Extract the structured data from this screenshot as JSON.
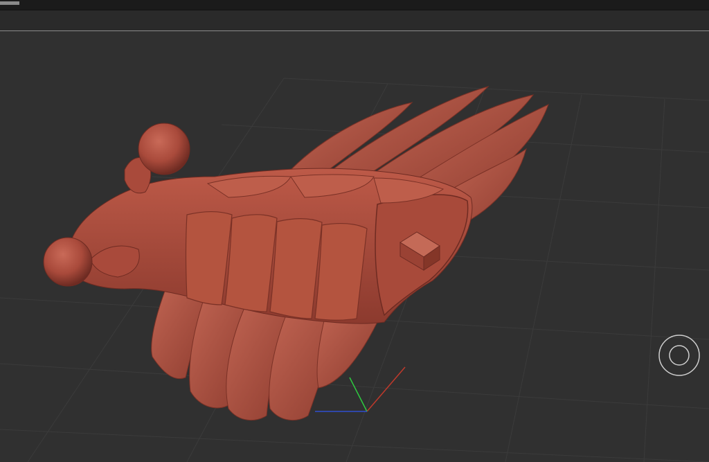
{
  "app": {
    "title": ""
  },
  "viewport": {
    "background": "#303030",
    "grid_color": "#3a3a3a",
    "model_color": "#b0503f",
    "model_shadow": "#7d3227",
    "model_highlight": "#c96a58"
  },
  "axes": {
    "x_color": "#c0392b",
    "y_color": "#2ecc40",
    "z_color": "#2f4fd0"
  },
  "navigation": {
    "gizmo_icon": "orbit-circle-icon"
  }
}
